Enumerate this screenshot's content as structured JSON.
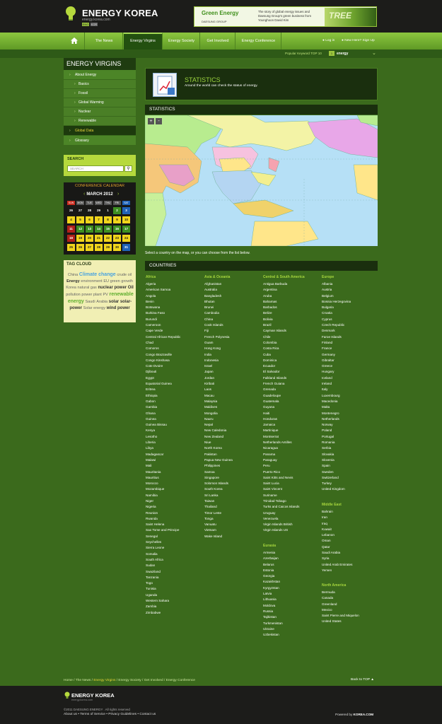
{
  "header": {
    "logo_title": "ENERGY KOREA",
    "logo_url": "energy.korea.com",
    "lang_en": "ENG",
    "lang_kr": "KOR",
    "ad": {
      "title": "Green Energy",
      "brand": "DAESUNG GROUP",
      "text": "The story of global energy issues and Daesung Group's green business from Younghoon David Kim",
      "image_text": "TREE"
    }
  },
  "nav": {
    "items": [
      "The News",
      "Energy Virgins",
      "Energy Society",
      "Get Involved",
      "Energy Conference"
    ],
    "active": "Energy Virgins",
    "login": "Log in",
    "signup": "New Here? Sign Up"
  },
  "keyword_bar": {
    "label": "Popular Keyword TOP 10",
    "rank": "1",
    "word": "energy"
  },
  "sidebar": {
    "title": "ENERGY VIRGINS",
    "items": [
      {
        "label": "About Energy",
        "level": 1
      },
      {
        "label": "Basics",
        "level": 2
      },
      {
        "label": "Fossil",
        "level": 2
      },
      {
        "label": "Global Warming",
        "level": 2
      },
      {
        "label": "Nuclear",
        "level": 2
      },
      {
        "label": "Renewable",
        "level": 2
      },
      {
        "label": "Global Data",
        "level": 1,
        "current": true
      },
      {
        "label": "Glossary",
        "level": 1
      }
    ]
  },
  "search": {
    "label": "SEARCH",
    "placeholder": "SEARCH"
  },
  "calendar": {
    "title": "CONFERENCE CALENDAR",
    "month": "MARCH 2012",
    "days": [
      "SUN",
      "MON",
      "TUE",
      "WED",
      "THU",
      "FRI",
      "SAT"
    ],
    "day_colors": [
      "#c72a1e",
      "#555555",
      "#555555",
      "#555555",
      "#555555",
      "#555555",
      "#1f62b8"
    ],
    "rows": [
      [
        26,
        27,
        28,
        29,
        1,
        2,
        3
      ],
      [
        4,
        5,
        6,
        7,
        8,
        9,
        10
      ],
      [
        11,
        12,
        13,
        14,
        15,
        16,
        17
      ],
      [
        18,
        19,
        20,
        21,
        22,
        23,
        24
      ],
      [
        25,
        26,
        27,
        28,
        29,
        30,
        31
      ]
    ],
    "cell_colors": [
      [
        "#181816",
        "#181816",
        "#181816",
        "#181816",
        "#181816",
        "#3d8f22",
        "#1f62b8"
      ],
      [
        "#f1d51b",
        "#f1d51b",
        "#f1d51b",
        "#f1d51b",
        "#f1d51b",
        "#f1d51b",
        "#f1d51b"
      ],
      [
        "#b0201a",
        "#3d8f22",
        "#3d8f22",
        "#3d8f22",
        "#3d8f22",
        "#3d8f22",
        "#3d8f22"
      ],
      [
        "#b0201a",
        "#f1d51b",
        "#f1d51b",
        "#f1d51b",
        "#f1d51b",
        "#f1d51b",
        "#f1d51b"
      ],
      [
        "#f1d51b",
        "#f1d51b",
        "#f1d51b",
        "#f1d51b",
        "#f1d51b",
        "#f1d51b",
        "#1f62b8"
      ]
    ]
  },
  "tag_cloud": {
    "title": "TAG CLOUD",
    "tags": [
      {
        "t": "China",
        "s": 5.5,
        "c": "#666"
      },
      {
        "t": "Climate change",
        "s": 7,
        "c": "#4aa3df",
        "b": true
      },
      {
        "t": "crude oil",
        "s": 5.5,
        "c": "#666"
      },
      {
        "t": "Energy",
        "s": 5.5,
        "c": "#333",
        "b": true
      },
      {
        "t": "environment",
        "s": 5.5,
        "c": "#666"
      },
      {
        "t": "EU",
        "s": 5.5,
        "c": "#666"
      },
      {
        "t": "green",
        "s": 5.5,
        "c": "#666"
      },
      {
        "t": "growth",
        "s": 5.5,
        "c": "#666"
      },
      {
        "t": "Korea",
        "s": 5.5,
        "c": "#666"
      },
      {
        "t": "natural gas",
        "s": 5.5,
        "c": "#666"
      },
      {
        "t": "nuclear",
        "s": 6,
        "c": "#333",
        "b": true
      },
      {
        "t": "power",
        "s": 6,
        "c": "#333",
        "b": true
      },
      {
        "t": "Oil",
        "s": 6,
        "c": "#333",
        "b": true
      },
      {
        "t": "pollution",
        "s": 5.5,
        "c": "#666"
      },
      {
        "t": "power plant",
        "s": 5.5,
        "c": "#666"
      },
      {
        "t": "PV",
        "s": 5.5,
        "c": "#666"
      },
      {
        "t": "renewable energy",
        "s": 7,
        "c": "#5fae2e",
        "b": true
      },
      {
        "t": "Saudi",
        "s": 5.5,
        "c": "#666"
      },
      {
        "t": "Arabia",
        "s": 5.5,
        "c": "#666"
      },
      {
        "t": "solar",
        "s": 6,
        "c": "#333",
        "b": true
      },
      {
        "t": "solar-power",
        "s": 6,
        "c": "#333",
        "b": true
      },
      {
        "t": "Solar",
        "s": 5.5,
        "c": "#666"
      },
      {
        "t": "energy",
        "s": 5.5,
        "c": "#666"
      },
      {
        "t": "wind power",
        "s": 6,
        "c": "#333",
        "b": true
      }
    ]
  },
  "statistics": {
    "title": "STATISTICS",
    "subtitle": "Around the world can check the status of energy.",
    "map_title": "STATISTICS",
    "zoom_in": "+",
    "zoom_out": "-",
    "note": "Select a country on the map, or you can choose from the list below.",
    "countries_title": "COUNTRIES"
  },
  "countries": {
    "africa": {
      "name": "Africa",
      "list": [
        "Algeria",
        "American Samoa",
        "Angola",
        "Benin",
        "Botswana",
        "Burkina Faso",
        "Burundi",
        "Cameroon",
        "Cape Verde",
        "Central African Republic",
        "Chad",
        "Comoros",
        "Congo Brazzaville",
        "Congo Kinshasa",
        "Cote Dvoire",
        "Djibouti",
        "Egypt",
        "Equatorial Guinea",
        "Eritrea",
        "Ethiopia",
        "Gabon",
        "Gambia",
        "Ghana",
        "Guinea",
        "Guinea Bissau",
        "Kenya",
        "Lesotho",
        "Liberia",
        "Libya",
        "Madagascar",
        "Malawi",
        "Mali",
        "Mauritania",
        "Mauritius",
        "Morocco",
        "Mozambique",
        "Namibia",
        "Niger",
        "Nigeria",
        "Reunion",
        "Rwanda",
        "Saint Helena",
        "Sao Tome and Principe",
        "Senegal",
        "Seychelles",
        "Sierra Leone",
        "Somalia",
        "South Africa",
        "Sudan",
        "Swaziland",
        "Tanzania",
        "Togo",
        "Tunisia",
        "Uganda",
        "Western Sahara",
        "Zambia",
        "Zimbabwe"
      ]
    },
    "asia": {
      "name": "Asia & Oceania",
      "list": [
        "Afghanistan",
        "Australia",
        "Bangladesh",
        "Bhutan",
        "Brunei",
        "Cambodia",
        "China",
        "Cook Islands",
        "Fiji",
        "French Polynesia",
        "Guam",
        "Hong Kong",
        "India",
        "Indonesia",
        "Israel",
        "Japan",
        "Jordan",
        "Kiribati",
        "Laos",
        "Macau",
        "Malaysia",
        "Maldives",
        "Mongolia",
        "Nauru",
        "Nepal",
        "New Caledonia",
        "New Zealand",
        "Niue",
        "North Korea",
        "Pakistan",
        "Papua New Guinea",
        "Philippines",
        "Samoa",
        "Singapore",
        "Solomon Islands",
        "South Korea",
        "Sri Lanka",
        "Taiwan",
        "Thailand",
        "Timor Leste",
        "Tonga",
        "Vanuatu",
        "Vietnam",
        "Wake Island"
      ]
    },
    "americas": {
      "name": "Central & South America",
      "list": [
        "Antigua Barbuda",
        "Argentina",
        "Aruba",
        "Bahamas",
        "Barbados",
        "Belize",
        "Bolivia",
        "Brazil",
        "Cayman Islands",
        "Chile",
        "Colombia",
        "Costa Rica",
        "Cuba",
        "Dominica",
        "Ecuador",
        "El Salvador",
        "Falkland Islands",
        "French Guiana",
        "Grenada",
        "Guadeloupe",
        "Guatemala",
        "Guyana",
        "Haiti",
        "Honduras",
        "Jamaica",
        "Martinique",
        "Montserrat",
        "Netherlands Antilles",
        "Nicaragua",
        "Panama",
        "Paraguay",
        "Peru",
        "Puerto Rico",
        "Saint Kitts and Nevis",
        "Saint Lucia",
        "Saint Vincent",
        "Suriname",
        "Trinidad Tobago",
        "Turks and Caicos Islands",
        "Uruguay",
        "Venezuela",
        "Virgin Islands British",
        "Virgin Islands US"
      ]
    },
    "eurasia": {
      "name": "Eurasia",
      "list": [
        "Armenia",
        "Azerbaijan",
        "Belarus",
        "Estonia",
        "Georgia",
        "Kazakhstan",
        "Kyrgyzstan",
        "Latvia",
        "Lithuania",
        "Moldova",
        "Russia",
        "Tajikistan",
        "Turkmenistan",
        "Ukraine",
        "Uzbekistan"
      ]
    },
    "europe": {
      "name": "Europe",
      "list": [
        "Albania",
        "Austria",
        "Belgium",
        "Bosnia Herzegovina",
        "Bulgaria",
        "Croatia",
        "Cyprus",
        "Czech Republic",
        "Denmark",
        "Faroe Islands",
        "Finland",
        "France",
        "Germany",
        "Gibraltar",
        "Greece",
        "Hungary",
        "Iceland",
        "Ireland",
        "Italy",
        "Luxembourg",
        "Macedonia",
        "Malta",
        "Montenegro",
        "Netherlands",
        "Norway",
        "Poland",
        "Portugal",
        "Romania",
        "Serbia",
        "Slovakia",
        "Slovenia",
        "Spain",
        "Sweden",
        "Switzerland",
        "Turkey",
        "United Kingdom"
      ]
    },
    "middle_east": {
      "name": "Middle East",
      "list": [
        "Bahrain",
        "Iran",
        "Iraq",
        "Kuwait",
        "Lebanon",
        "Oman",
        "Qatar",
        "Saudi Arabia",
        "Syria",
        "United Arab Emirates",
        "Yemen"
      ]
    },
    "north_america": {
      "name": "North America",
      "list": [
        "Bermuda",
        "Canada",
        "Greenland",
        "Mexico",
        "Saint Pierre and Miquelon",
        "United States"
      ]
    }
  },
  "breadcrumb": {
    "items": [
      "Home",
      "The News",
      "Energy Virgins",
      "Energy Society",
      "Get Involved",
      "Energy Conference"
    ],
    "current": "Energy Virgins",
    "back_to_top": "Back to TOP"
  },
  "footer": {
    "logo": "ENERGY KOREA",
    "url": "energy.korea.com",
    "copyright": "©2011 DAESUNG ENERGY . All rights reserved",
    "links": [
      "About us",
      "Terms of Service",
      "Privacy Guidelines",
      "Contact us"
    ],
    "powered_label": "Powered by",
    "powered_brand": "KOREA.COM"
  }
}
